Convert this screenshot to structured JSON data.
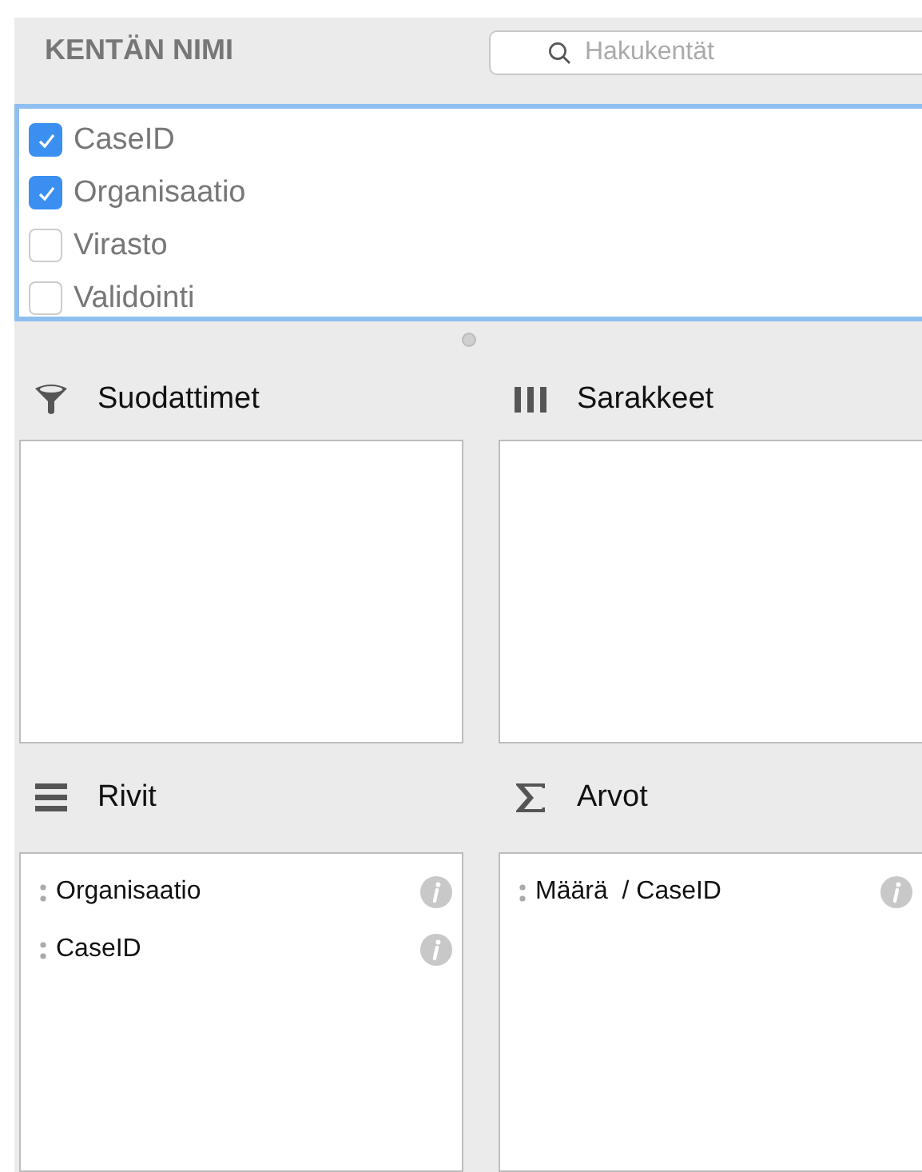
{
  "header": {
    "title": "KENTÄN NIMI",
    "search": {
      "placeholder": "Hakukentät"
    }
  },
  "fields": [
    {
      "label": "CaseID",
      "checked": true
    },
    {
      "label": "Organisaatio",
      "checked": true
    },
    {
      "label": "Virasto",
      "checked": false
    },
    {
      "label": "Validointi",
      "checked": false
    }
  ],
  "areas": [
    {
      "kind": "filters",
      "title": "Suodattimet"
    },
    {
      "kind": "columns",
      "title": "Sarakkeet"
    },
    {
      "kind": "rows",
      "title": "Rivit",
      "items": [
        {
          "label": "Organisaatio"
        },
        {
          "label": "CaseID"
        }
      ]
    },
    {
      "kind": "values",
      "title": "Arvot",
      "items": [
        {
          "label": "Määrä  / CaseID"
        }
      ]
    }
  ]
}
